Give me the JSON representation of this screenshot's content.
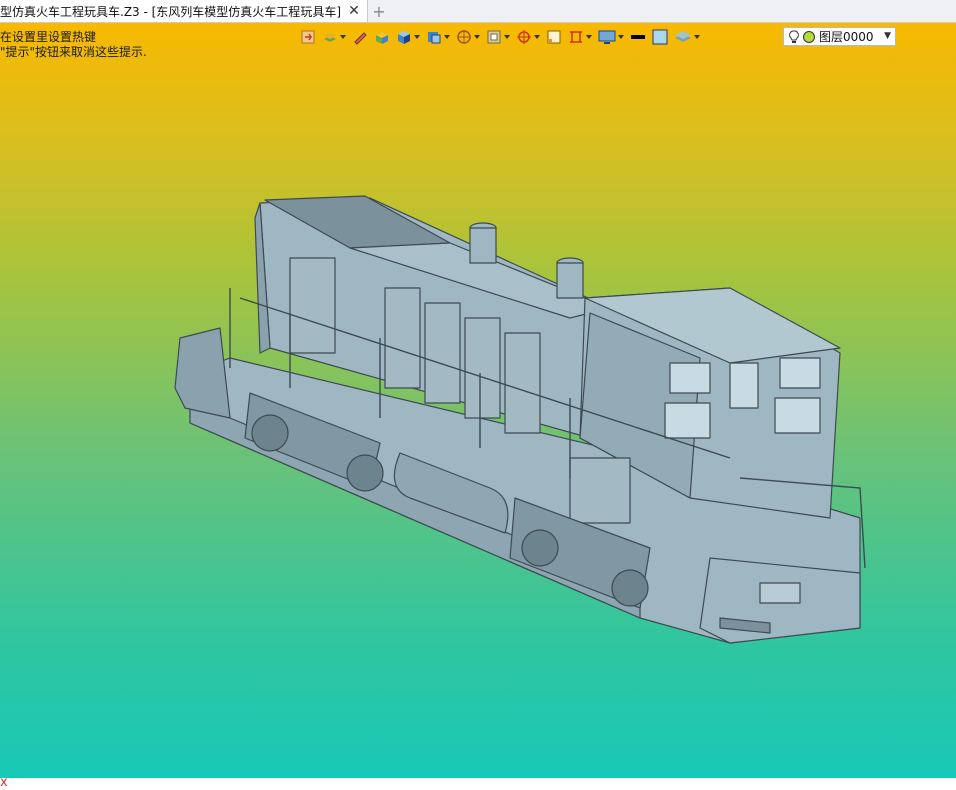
{
  "window": {
    "tab_title": "型仿真火车工程玩具车.Z3 - [东风列车模型仿真火车工程玩具车]",
    "close_symbol": "✕",
    "add_symbol": "+"
  },
  "viewport": {
    "hint_line1": "在设置里设置热键",
    "hint_line2": "\"提示\"按钮来取消这些提示.",
    "axis_mark": "x"
  },
  "toolbar": {
    "icons": [
      "import-icon",
      "layers-stack-icon",
      "pencil-icon",
      "solid-box-icon",
      "cube-blue-icon",
      "view-cube-icon",
      "render-mode-icon",
      "frame-icon",
      "snap-target-icon",
      "sketch-square-icon",
      "dimension-icon",
      "display-options-icon",
      "line-color-icon",
      "fill-color-icon",
      "layer-manager-icon"
    ],
    "layer_label": "图层0000",
    "colors": {
      "line": "#000000",
      "fill": "#a8d8f0"
    }
  },
  "theme": {
    "gradient_top": "#f8b900",
    "gradient_bottom": "#18c9b8",
    "model_fill": "#9fb7c2",
    "model_edge": "#3d4a52"
  }
}
